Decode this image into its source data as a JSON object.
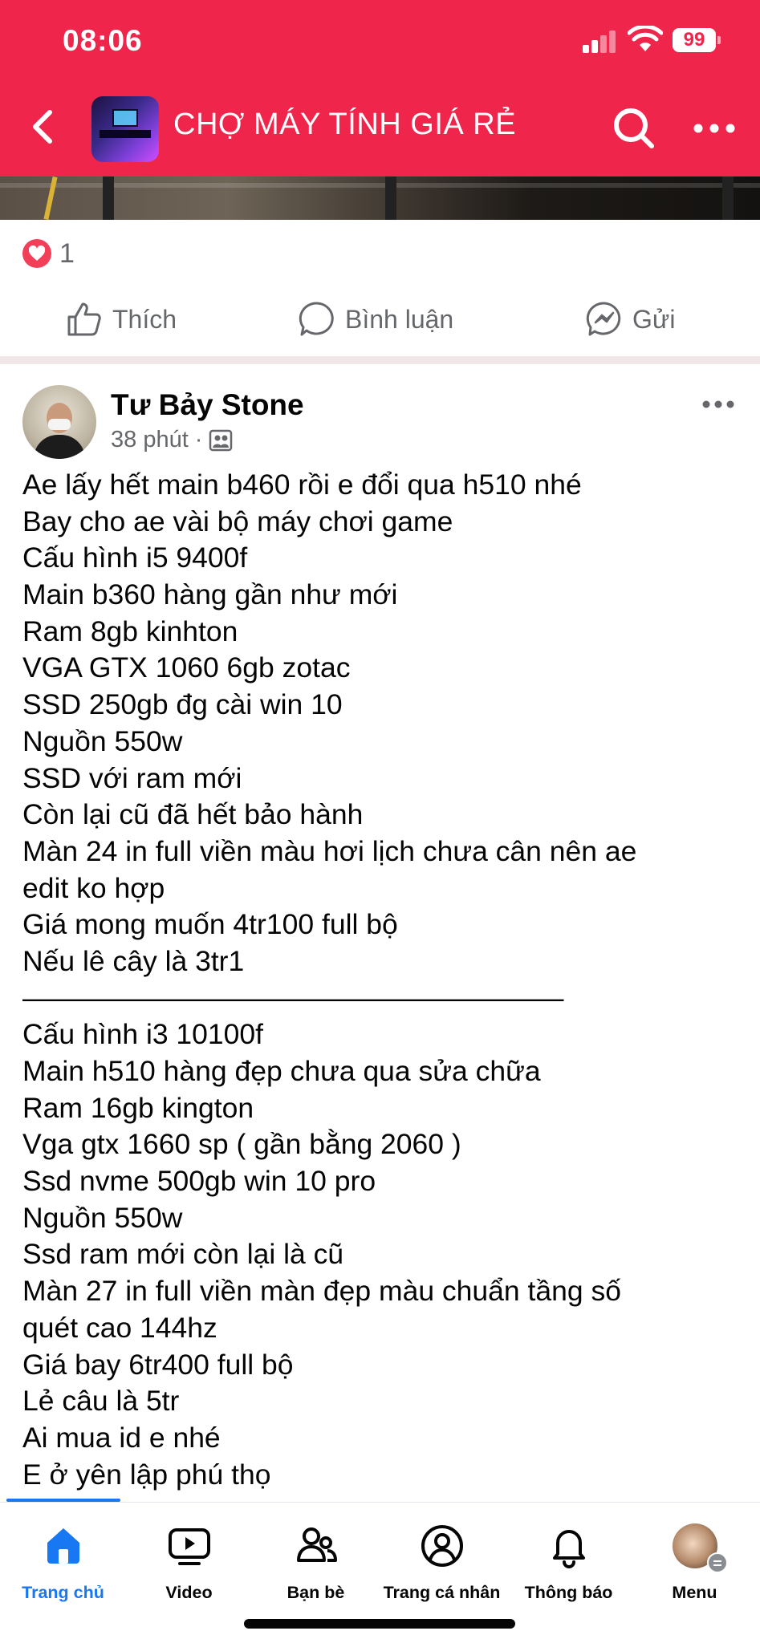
{
  "status_bar": {
    "time": "08:06",
    "battery": "99"
  },
  "header": {
    "group_name": "CHỢ MÁY TÍNH GIÁ RẺ"
  },
  "reactions": {
    "count": "1"
  },
  "actions": {
    "like": "Thích",
    "comment": "Bình luận",
    "send": "Gửi"
  },
  "post": {
    "author": "Tư Bảy Stone",
    "time_ago": "38 phút",
    "separator": "·",
    "body_lines": [
      "Ae lấy hết main b460 rồi e đổi qua h510 nhé",
      "Bay cho ae vài bộ máy chơi game",
      "Cấu hình i5 9400f",
      "Main b360 hàng gần như mới",
      "Ram 8gb kinhton",
      "VGA GTX 1060 6gb zotac",
      "SSD 250gb đg cài win 10",
      "Nguồn 550w",
      "SSD với ram mới",
      "Còn lại cũ đã hết bảo hành",
      "Màn 24 in full viền màu hơi lịch chưa cân nên ae",
      "edit ko hợp",
      "Giá mong muốn 4tr100 full bộ",
      "Nếu lê cây là 3tr1",
      "———————————————————",
      "Cấu hình i3 10100f",
      "Main h510 hàng đẹp chưa qua sửa chữa",
      "Ram 16gb kington",
      "Vga gtx 1660 sp ( gần bằng 2060 )",
      "Ssd nvme 500gb win 10 pro",
      "Nguồn 550w",
      "Ssd ram mới còn lại là cũ",
      "Màn 27 in full viền màn đẹp màu chuẩn tầng số",
      "quét cao 144hz",
      "Giá bay 6tr400 full bộ",
      "Lẻ câu là 5tr",
      "Ai mua id e nhé",
      "E ở yên lập phú thọ"
    ]
  },
  "bottom_nav": [
    {
      "label": "Trang chủ",
      "icon": "home-icon",
      "active": true
    },
    {
      "label": "Video",
      "icon": "video-icon",
      "active": false
    },
    {
      "label": "Bạn bè",
      "icon": "friends-icon",
      "active": false
    },
    {
      "label": "Trang cá nhân",
      "icon": "profile-icon",
      "active": false
    },
    {
      "label": "Thông báo",
      "icon": "bell-icon",
      "active": false
    },
    {
      "label": "Menu",
      "icon": "menu-avatar",
      "active": false
    }
  ],
  "colors": {
    "brand": "#f0254b",
    "accent": "#1877f2",
    "heart": "#f33e58",
    "secondary_text": "#65676b"
  }
}
